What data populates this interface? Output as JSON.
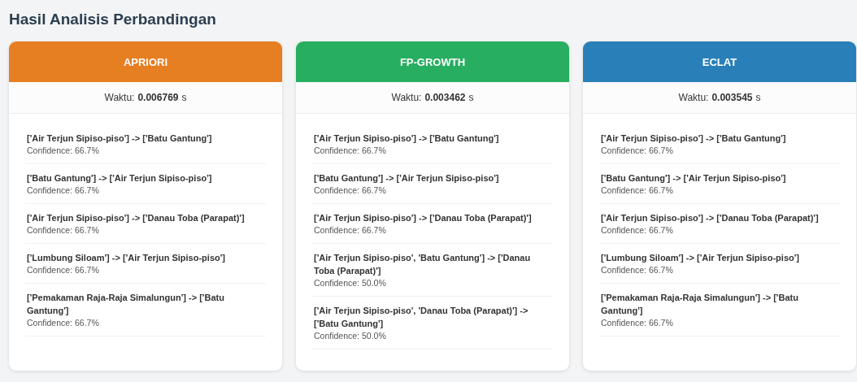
{
  "title": "Hasil Analisis Perbandingan",
  "cards": [
    {
      "name": "APRIORI",
      "color": "#e67e22",
      "time": "Waktu: **0.006769** s",
      "rules": [
        {
          "rule": "['Air Terjun Sipiso-piso'] -> ['Batu Gantung']",
          "confidence": "Confidence: 66.7%"
        },
        {
          "rule": "['Batu Gantung'] -> ['Air Terjun Sipiso-piso']",
          "confidence": "Confidence: 66.7%"
        },
        {
          "rule": "['Air Terjun Sipiso-piso'] -> ['Danau Toba (Parapat)']",
          "confidence": "Confidence: 66.7%"
        },
        {
          "rule": "['Lumbung Siloam'] -> ['Air Terjun Sipiso-piso']",
          "confidence": "Confidence: 66.7%"
        },
        {
          "rule": "['Pemakaman Raja-Raja Simalungun'] -> ['Batu Gantung']",
          "confidence": "Confidence: 66.7%"
        }
      ]
    },
    {
      "name": "FP-GROWTH",
      "color": "#27ae60",
      "time": "Waktu: **0.003462** s",
      "rules": [
        {
          "rule": "['Air Terjun Sipiso-piso'] -> ['Batu Gantung']",
          "confidence": "Confidence: 66.7%"
        },
        {
          "rule": "['Batu Gantung'] -> ['Air Terjun Sipiso-piso']",
          "confidence": "Confidence: 66.7%"
        },
        {
          "rule": "['Air Terjun Sipiso-piso'] -> ['Danau Toba (Parapat)']",
          "confidence": "Confidence: 66.7%"
        },
        {
          "rule": "['Air Terjun Sipiso-piso', 'Batu Gantung'] -> ['Danau Toba (Parapat)']",
          "confidence": "Confidence: 50.0%"
        },
        {
          "rule": "['Air Terjun Sipiso-piso', 'Danau Toba (Parapat)'] -> ['Batu Gantung']",
          "confidence": "Confidence: 50.0%"
        }
      ]
    },
    {
      "name": "ECLAT",
      "color": "#2980b9",
      "time": "Waktu: **0.003545** s",
      "rules": [
        {
          "rule": "['Air Terjun Sipiso-piso'] -> ['Batu Gantung']",
          "confidence": "Confidence: 66.7%"
        },
        {
          "rule": "['Batu Gantung'] -> ['Air Terjun Sipiso-piso']",
          "confidence": "Confidence: 66.7%"
        },
        {
          "rule": "['Air Terjun Sipiso-piso'] -> ['Danau Toba (Parapat)']",
          "confidence": "Confidence: 66.7%"
        },
        {
          "rule": "['Lumbung Siloam'] -> ['Air Terjun Sipiso-piso']",
          "confidence": "Confidence: 66.7%"
        },
        {
          "rule": "['Pemakaman Raja-Raja Simalungun'] -> ['Batu Gantung']",
          "confidence": "Confidence: 66.7%"
        }
      ]
    }
  ]
}
